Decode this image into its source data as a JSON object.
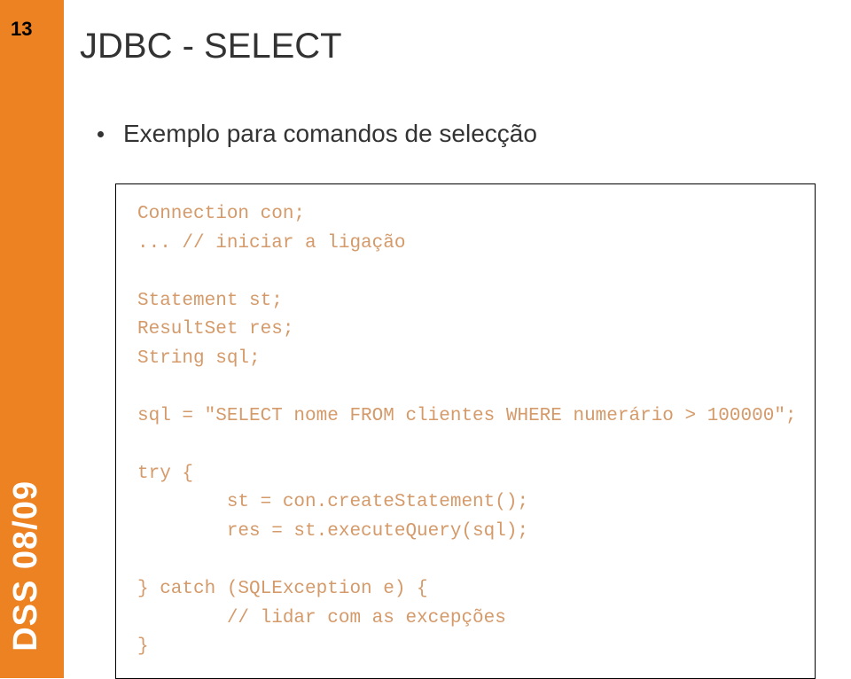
{
  "page_number": "13",
  "sidebar_label": "DSS 08/09",
  "title": "JDBC - SELECT",
  "bullet": "Exemplo para comandos de selecção",
  "code": {
    "l1": "Connection con;",
    "l2": "... // iniciar a ligação",
    "l3": "Statement st;",
    "l4": "ResultSet res;",
    "l5": "String sql;",
    "l6": "sql = \"SELECT nome FROM clientes WHERE numerário > 100000\";",
    "l7": "try {",
    "l8": "        st = con.createStatement();",
    "l9": "        res = st.executeQuery(sql);",
    "l10": "} catch (SQLException e) {",
    "l11": "        // lidar com as excepções",
    "l12": "}"
  }
}
